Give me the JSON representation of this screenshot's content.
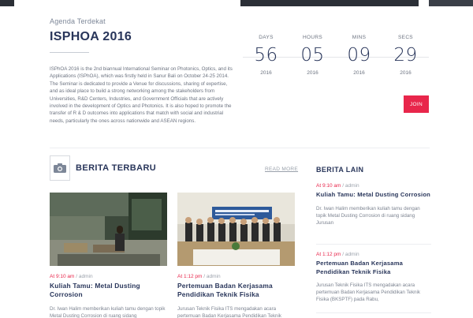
{
  "agenda": {
    "label": "Agenda Terdekat",
    "title": "ISPHOA 2016",
    "description": "ISPhOA 2016 is the 2nd biannual International Seminar on Photonics, Optics, and its Applications (ISPhOA), which was firstly held in Sanur Bali on October 24-25 2014. The Seminar is dedicated to provide a Venue for discussions, sharing of expertise, and as ideal place to build a strong networking among the stakeholders from Universities, R&D Centers, Industries, and Government Officials that are actively involved in the development of Optics and Photonics. It is also hoped to promote the transfer of R & D outcomes into applications that match with social and industrial needs, particularly the ones across nationwide and ASEAN regions."
  },
  "countdown": [
    {
      "label": "DAYS",
      "value": "56",
      "year": "2016"
    },
    {
      "label": "HOURS",
      "value": "05",
      "year": "2016"
    },
    {
      "label": "MINS",
      "value": "09",
      "year": "2016"
    },
    {
      "label": "SECS",
      "value": "29",
      "year": "2016"
    }
  ],
  "join_label": "JOIN",
  "news": {
    "heading": "BERITA TERBARU",
    "read_more": "READ MORE",
    "camera_icon": "camera-icon",
    "cards": [
      {
        "time": "At 9:10 am",
        "sep": " / ",
        "author": "admin",
        "title": "Kuliah Tamu: Metal Dusting Corrosion",
        "text": "Dr. Iwan Halim memberikan kuliah tamu dengan topik Metal Dusting Corrosion di ruang sidang"
      },
      {
        "time": "At 1:12 pm",
        "sep": " / ",
        "author": "admin",
        "title": "Pertemuan Badan Kerjasama Pendidikan Teknik Fisika",
        "text": "Jurusan Teknik Fisika ITS mengadakan acara pertemuan Badan Kerjasama Pendidikan Teknik"
      }
    ]
  },
  "side": {
    "heading": "BERITA LAIN",
    "items": [
      {
        "time": "At 9:10 am",
        "sep": " / ",
        "author": "admin",
        "title": "Kuliah Tamu: Metal Dusting Corrosion",
        "text": "Dr. Iwan Halim memberikan kuliah tamu dengan topik Metal Dusting Corrosion di ruang sidang Jurusan"
      },
      {
        "time": "At 1:12 pm",
        "sep": " / ",
        "author": "admin",
        "title": "Pertemuan Badan Kerjasama Pendidikan Teknik Fisika",
        "text": "Jurusan Teknik Fisika ITS mengadakan acara pertemuan Badan Kerjasama Pendidikan Teknik Fisika (BKSPTF) pada Rabu,"
      }
    ]
  },
  "colors": {
    "accent": "#e8264b",
    "navy": "#28355a"
  }
}
